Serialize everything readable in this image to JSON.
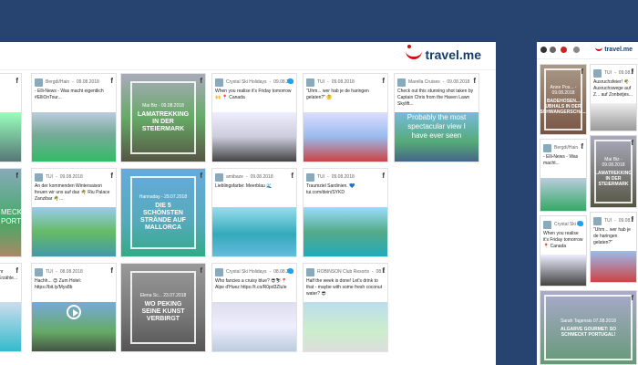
{
  "brand": {
    "name": "travel.me"
  },
  "colors": {
    "background": "#26446f",
    "brand_red": "#d40e14",
    "brand_blue": "#123e6e"
  },
  "cards": [
    {
      "id": "c1",
      "network": "f",
      "text": ""
    },
    {
      "id": "c2",
      "author": "Bergdi/Hain",
      "date": "09.08.2018",
      "network": "f",
      "text": "- Elli-News - Was macht eigentlich #ElliOnTour..."
    },
    {
      "id": "c3",
      "network": "f",
      "tag_date": "Mai Biz - 09.08.2018",
      "tag_title": "LAMATREKKING IN DER STEIERMARK"
    },
    {
      "id": "c4",
      "author": "Crystal Ski Holidays",
      "date": "09.08.2018",
      "network": "tw",
      "text": "When you realise it's Friday tomorrow 🙌 📍 Canada"
    },
    {
      "id": "c5",
      "author": "TUI",
      "date": "09.08.2018",
      "network": "f",
      "text": "\"Uhm... wer hab je de haringen gelaten?\" 🤔"
    },
    {
      "id": "c6",
      "author": "Marella Cruises",
      "date": "09.08.2018",
      "network": "f",
      "text": "Check out this stunning shot taken by Captain Chris from the Haven Lawn Skylift...",
      "overlay": "Probably the most spectacular view I have ever seen"
    },
    {
      "id": "c7",
      "network": "f",
      "overlay": "MECKT PORTUGAL!"
    },
    {
      "id": "c8",
      "author": "TUI",
      "date": "09.08.2018",
      "network": "f",
      "text": "An der kommenden Wintersaison freuen wir uns auf das 🌴 Riu Palace Zanzibar 🌴..."
    },
    {
      "id": "c9",
      "network": "f",
      "tag_date": "Hannaday - 29.07.2018",
      "tag_title": "DIE 5 SCHÖNSTEN STRÄNDE AUF MALLORCA"
    },
    {
      "id": "c10",
      "author": "amibaze",
      "date": "09.08.2018",
      "network": "f",
      "text": "Lieblingsfarbe: Meerblau 🌊"
    },
    {
      "id": "c11",
      "author": "TUI",
      "date": "09.08.2018",
      "network": "f",
      "text": "Traumziel Sardinien. 💙 tui.com/dein/SYKD"
    },
    {
      "id": "c12",
      "network": "f",
      "text": "ihr Erzähle..."
    },
    {
      "id": "c13",
      "author": "TUI",
      "date": "08.08.2018",
      "network": "f",
      "text": "Hachh... 😍 Zum Hotel: https://bit.ly/Mys8b"
    },
    {
      "id": "c14",
      "network": "f",
      "tag_date": "Elena Sc... 23.07.2018",
      "tag_title": "WO PEKING SEINE KUNST VERBIRGT"
    },
    {
      "id": "c15",
      "author": "Crystal Ski Holidays",
      "date": "08.08.2018",
      "network": "tw",
      "text": "Who fancies a cruisy blue? 😎⛷📍 Alpe d'Huez https://t.co/R0pd3ZluIe"
    },
    {
      "id": "c16",
      "author": "ROBINSON Club Resorts",
      "date": "08.08.2018",
      "network": "f",
      "text": "Half the week is done! Let's drink to that - maybe with some fresh coconut water? 😎"
    }
  ],
  "mobile": {
    "brand": "travel.me",
    "cards": [
      {
        "id": "m1",
        "network": "f",
        "tag_date": "Anne Pos... - 09.08.2018",
        "tag_title": "BADEHOSEN... UBHALS IN DER SCHWANGERSCHA..."
      },
      {
        "id": "m2",
        "author": "TUI",
        "date": "09.08.2018",
        "network": "f",
        "text": "Ausruchsfeier! 🌴 Ausruchswege auf Z... auf Zonbetjes..."
      },
      {
        "id": "m3",
        "author": "Bergdi/Hain",
        "date": "09.08.2018",
        "network": "f",
        "text": "- Elli-News - Was macht..."
      },
      {
        "id": "m4",
        "network": "f",
        "tag_date": "Mai Biz - 09.08.2018",
        "tag_title": "LAMATREKKING IN DER STEIERMARK"
      },
      {
        "id": "m5",
        "author": "Crystal Ski Holidays",
        "date": "09.08.2018",
        "network": "tw",
        "text": "When you realise it's Friday tomorrow 📍 Canada"
      },
      {
        "id": "m6",
        "author": "TUI",
        "date": "09.08.2018",
        "network": "f",
        "text": "\"Uhm... wer hab je de haringen gelaten?\""
      },
      {
        "id": "m7",
        "network": "f",
        "tag_date": "Sarah Tagensis 07.08.2018",
        "tag_title": "ALGARVE GOURMET: SO SCHMECKT PORTUGAL!"
      }
    ]
  }
}
